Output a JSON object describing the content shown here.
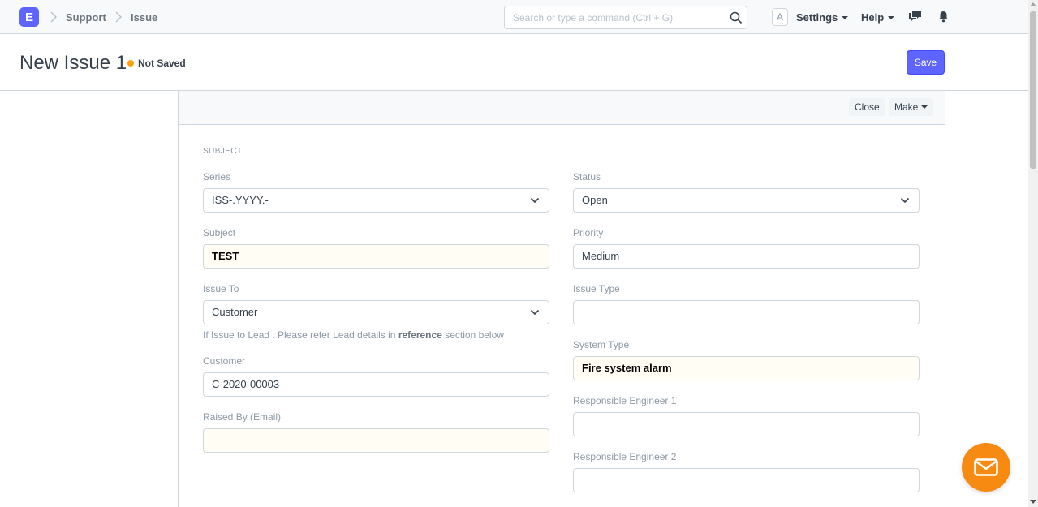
{
  "navbar": {
    "brand_letter": "E",
    "breadcrumbs": [
      "Support",
      "Issue"
    ],
    "search_placeholder": "Search or type a command (Ctrl + G)",
    "avatar_letter": "A",
    "settings_label": "Settings",
    "help_label": "Help"
  },
  "page": {
    "title": "New Issue 1",
    "status": "Not Saved",
    "status_color": "#ffa00a",
    "save_label": "Save",
    "accent_color": "#5e64ff"
  },
  "toolbar": {
    "close_label": "Close",
    "make_label": "Make"
  },
  "form": {
    "section_title": "SUBJECT",
    "left": {
      "series": {
        "label": "Series",
        "value": "ISS-.YYYY.-"
      },
      "subject": {
        "label": "Subject",
        "value": "TEST"
      },
      "issue_to": {
        "label": "Issue To",
        "value": "Customer"
      },
      "help_pre": "If Issue to Lead . Please refer Lead details in ",
      "help_bold": "reference",
      "help_post": " section below",
      "customer": {
        "label": "Customer",
        "value": "C-2020-00003"
      },
      "raised_by": {
        "label": "Raised By (Email)",
        "value": ""
      }
    },
    "right": {
      "status": {
        "label": "Status",
        "value": "Open"
      },
      "priority": {
        "label": "Priority",
        "value": "Medium"
      },
      "issue_type": {
        "label": "Issue Type",
        "value": ""
      },
      "system_type": {
        "label": "System Type",
        "value": "Fire system alarm"
      },
      "engineer1": {
        "label": "Responsible Engineer 1",
        "value": ""
      },
      "engineer2": {
        "label": "Responsible Engineer 2",
        "value": ""
      }
    }
  },
  "fab": {
    "icon": "mail-icon",
    "color": "#f78a10"
  }
}
